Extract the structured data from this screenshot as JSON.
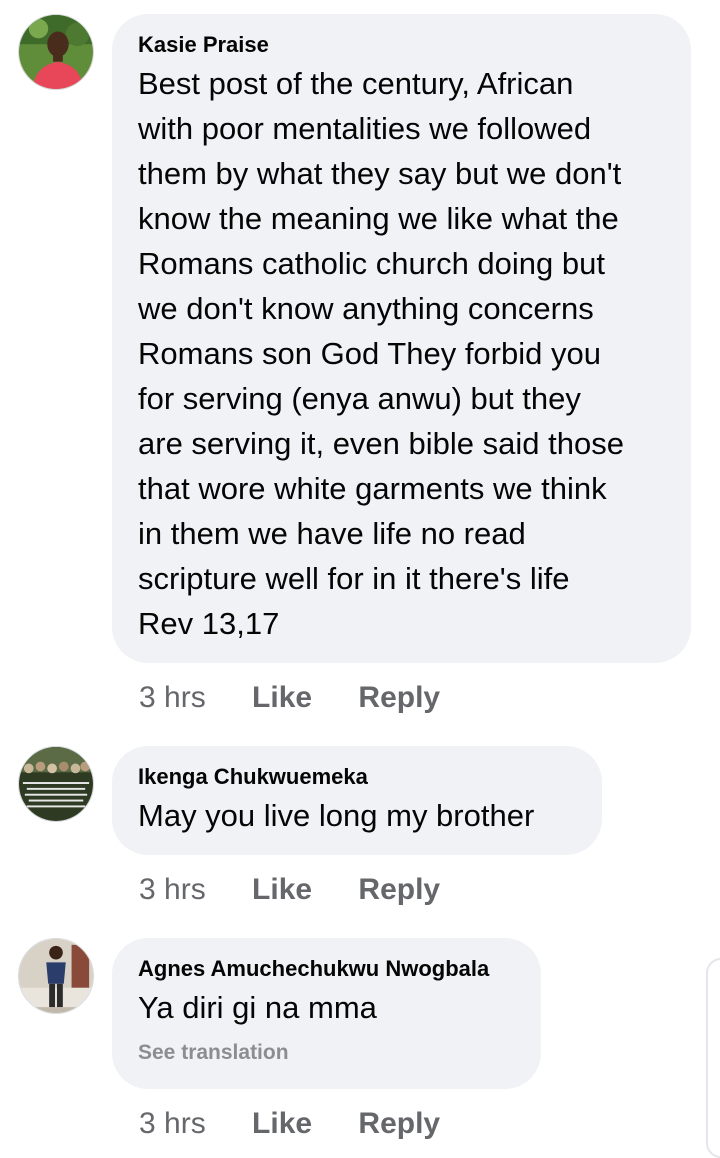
{
  "comments": [
    {
      "author": "Kasie Praise",
      "text": "Best post of the century, African\nwith poor mentalities we followed\nthem by what they say but we don't\nknow the meaning we like what the\nRomans catholic church doing but\nwe don't know anything concerns\nRomans son God They forbid you\nfor serving (enya anwu) but they\nare serving it, even bible said those\nthat wore white garments we think\nin them we have life no read\nscripture well for in it there's life\nRev 13,17",
      "time": "3 hrs",
      "like_label": "Like",
      "reply_label": "Reply",
      "avatar_icon": "person-red-shirt-avatar"
    },
    {
      "author": "Ikenga Chukwuemeka",
      "text": "May you live long my brother",
      "time": "3 hrs",
      "like_label": "Like",
      "reply_label": "Reply",
      "avatar_icon": "crowd-photo-avatar"
    },
    {
      "author": "Agnes Amuchechukwu Nwogbala",
      "text": "Ya diri gi na mma",
      "see_translation": "See translation",
      "time": "3 hrs",
      "like_label": "Like",
      "reply_label": "Reply",
      "avatar_icon": "person-standing-avatar"
    }
  ],
  "colors": {
    "bubble_bg": "#f0f2f5",
    "secondary_text": "#65676b",
    "primary_text": "#050505"
  }
}
